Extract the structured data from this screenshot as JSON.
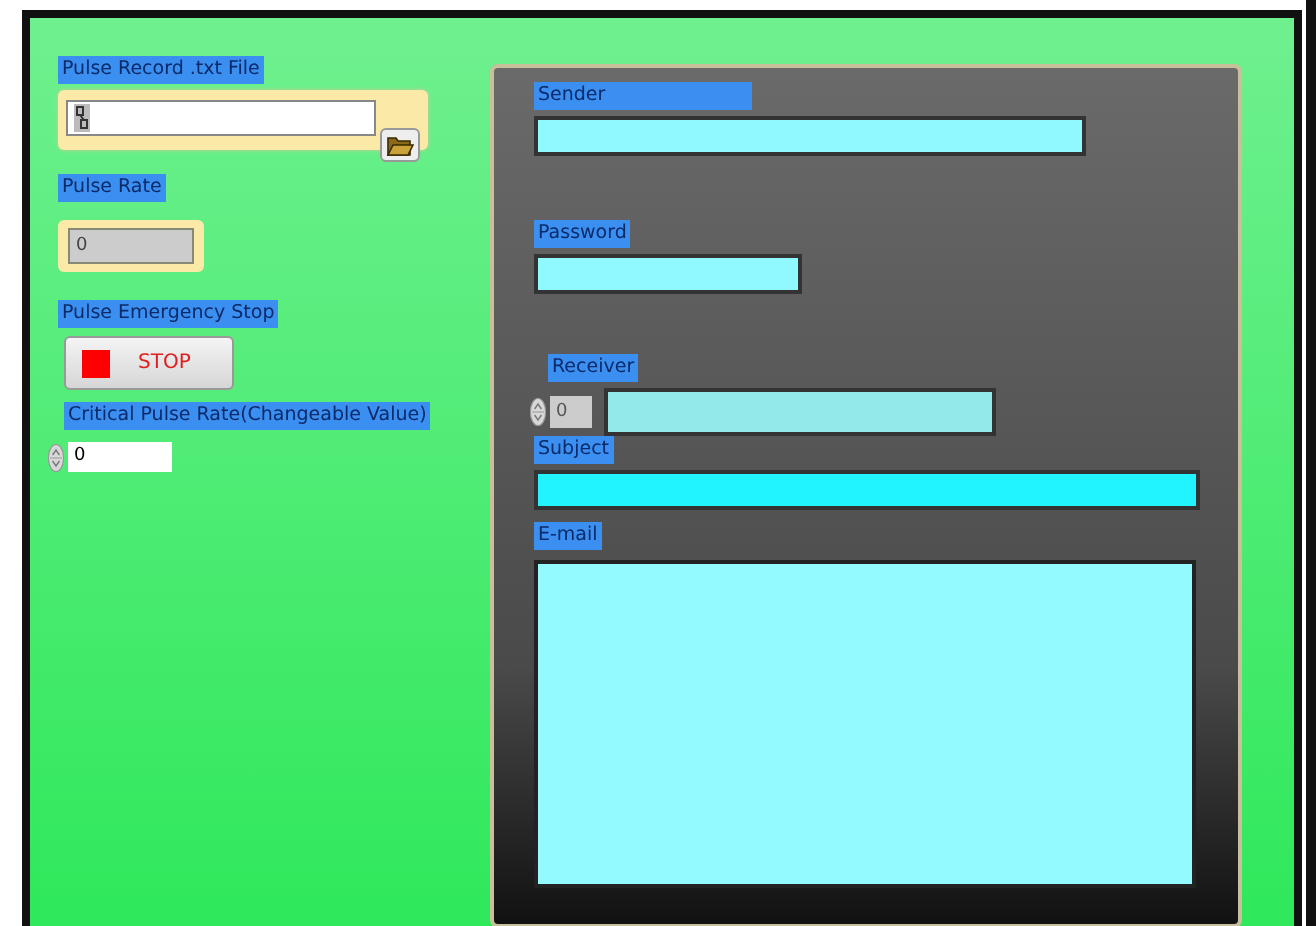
{
  "left": {
    "path_control": {
      "label": "Pulse Record .txt File"
    },
    "pulse_rate": {
      "label": "Pulse Rate",
      "value": "0"
    },
    "stop_button": {
      "label": "Pulse Emergency Stop",
      "text": "STOP"
    },
    "critical_rate": {
      "label": "Critical Pulse Rate(Changeable Value)",
      "value": "0"
    }
  },
  "email_panel": {
    "fields": [
      {
        "kind": "text",
        "label": "Sender"
      },
      {
        "kind": "text",
        "label": "Password"
      },
      {
        "kind": "receiver",
        "label": "Receiver",
        "index": "0"
      },
      {
        "kind": "text",
        "label": "Subject"
      },
      {
        "kind": "textarea",
        "label": "E-mail"
      }
    ]
  }
}
